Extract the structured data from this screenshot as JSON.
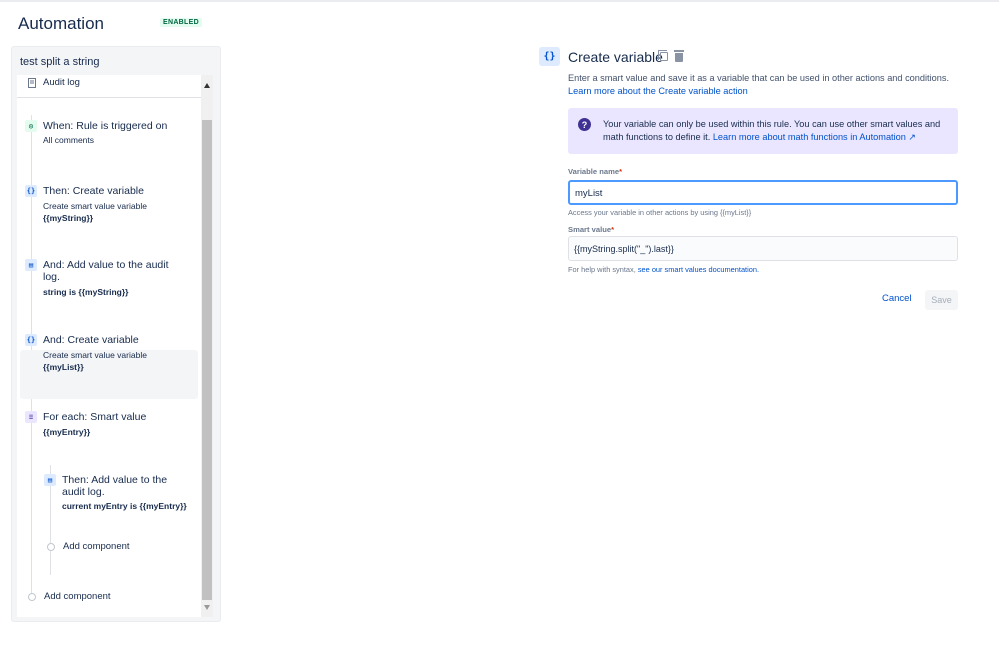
{
  "app": {
    "title": "Automation",
    "status_badge": "ENABLED"
  },
  "rule": {
    "name": "test split a string",
    "audit_log_label": "Audit log",
    "steps": [
      {
        "icon": "trigger-icon",
        "title": "When: Rule is triggered on",
        "sub": "All comments",
        "bold": ""
      },
      {
        "icon": "variable-icon",
        "title": "Then: Create variable",
        "sub": "Create smart value variable",
        "bold": "{{myString}}"
      },
      {
        "icon": "audit-log-icon",
        "title": "And: Add value to the audit log.",
        "sub": "",
        "bold": "string is {{myString}}"
      },
      {
        "icon": "variable-icon",
        "title": "And: Create variable",
        "sub": "Create smart value variable",
        "bold": "{{myList}}"
      },
      {
        "icon": "branch-icon",
        "title": "For each: Smart value",
        "sub": "",
        "bold": "{{myEntry}}"
      },
      {
        "icon": "audit-log-icon",
        "title": "Then: Add value to the audit log.",
        "sub": "",
        "bold": "current myEntry is {{myEntry}}"
      }
    ],
    "add_component_inner": "Add component",
    "add_component_outer": "Add component"
  },
  "editor": {
    "icon": "{}",
    "title": "Create variable",
    "description": "Enter a smart value and save it as a variable that can be used in other actions and conditions.",
    "description_link": "Learn more about the Create variable action",
    "info_text": "Your variable can only be used within this rule. You can use other smart values and math functions to define it.",
    "info_link": "Learn more about math functions in Automation ↗",
    "variable_name_label": "Variable name",
    "variable_name_value": "myList",
    "variable_name_help": "Access your variable in other actions by using {{myList}}",
    "smart_value_label": "Smart value",
    "smart_value_value": "{{myString.split(\"_\").last}}",
    "smart_value_help": "For help with syntax,",
    "smart_value_help_link": "see our smart values documentation.",
    "cancel_label": "Cancel",
    "save_label": "Save"
  }
}
